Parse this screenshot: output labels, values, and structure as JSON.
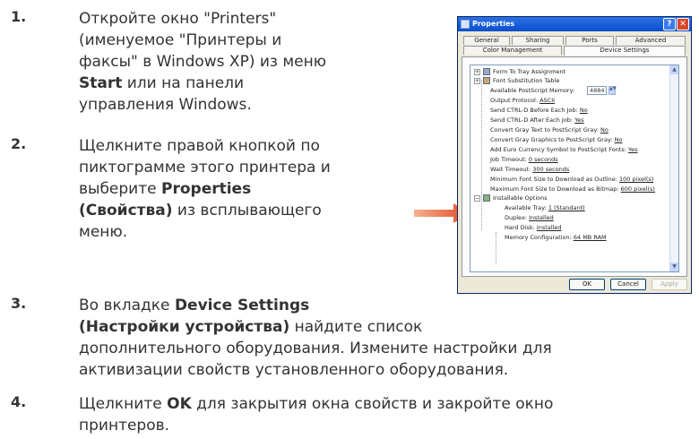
{
  "steps": [
    {
      "number": "1.",
      "lines": [
        [
          {
            "text": "Откройте окно \"Printers\""
          }
        ],
        [
          {
            "text": "(именуемое \"Принтеры и"
          }
        ],
        [
          {
            "text": "факсы\" в Windows XP) из меню"
          }
        ],
        [
          {
            "text": "Start",
            "bold": true
          },
          {
            "text": " или на панели"
          }
        ],
        [
          {
            "text": "управления Windows."
          }
        ]
      ]
    },
    {
      "number": "2.",
      "lines": [
        [
          {
            "text": "Щелкните правой кнопкой по"
          }
        ],
        [
          {
            "text": "пиктограмме этого принтера и"
          }
        ],
        [
          {
            "text": "выберите "
          },
          {
            "text": "Properties",
            "bold": true
          }
        ],
        [
          {
            "text": "(Свойства)",
            "bold": true
          },
          {
            "text": " из всплывающего"
          }
        ],
        [
          {
            "text": "меню."
          }
        ]
      ]
    },
    {
      "number": "3.",
      "lines": [
        [
          {
            "text": "Во вкладке "
          },
          {
            "text": "Device Settings",
            "bold": true
          }
        ],
        [
          {
            "text": "(Настройки устройства)",
            "bold": true
          },
          {
            "text": " найдите список"
          }
        ],
        [
          {
            "text": "дополнительного оборудования. Измените настройки для"
          }
        ],
        [
          {
            "text": "активизации свойств установленного оборудования."
          }
        ]
      ]
    },
    {
      "number": "4.",
      "lines": [
        [
          {
            "text": "Щелкните "
          },
          {
            "text": "OK",
            "bold": true
          },
          {
            "text": " для закрытия окна свойств и закройте окно"
          }
        ],
        [
          {
            "text": "принтеров."
          }
        ]
      ]
    }
  ],
  "dialog": {
    "title": "Properties",
    "help_glyph": "?",
    "close_glyph": "✕",
    "tabs_row1": [
      "General",
      "Sharing",
      "Ports",
      "Advanced"
    ],
    "tabs_row2": [
      "Color Management",
      "Device Settings"
    ],
    "active_tab": "Device Settings",
    "tree": {
      "form_to_tray": "Form To Tray Assignment",
      "font_substitution": "Font Substitution Table",
      "ps_memory_label": "Available PostScript Memory:",
      "ps_memory_value": "4884",
      "output_protocol_label": "Output Protocol:",
      "output_protocol_value": "ASCII",
      "ctrl_d_before_label": "Send CTRL-D Before Each Job:",
      "ctrl_d_before_value": "No",
      "ctrl_d_after_label": "Send CTRL-D After Each Job:",
      "ctrl_d_after_value": "Yes",
      "gray_text_label": "Convert Gray Text to PostScript Gray:",
      "gray_text_value": "No",
      "gray_graphics_label": "Convert Gray Graphics to PostScript Gray:",
      "gray_graphics_value": "No",
      "euro_label": "Add Euro Currency Symbol to PostScript Fonts:",
      "euro_value": "Yes",
      "job_timeout_label": "Job Timeout:",
      "job_timeout_value": "0 seconds",
      "wait_timeout_label": "Wait Timeout:",
      "wait_timeout_value": "300 seconds",
      "min_font_label": "Minimum Font Size to Download as Outline:",
      "min_font_value": "100 pixel(s)",
      "max_font_label": "Maximum Font Size to Download as Bitmap:",
      "max_font_value": "600 pixel(s)",
      "installable_options": "Installable Options",
      "tray_label": "Available Tray:",
      "tray_value": "1 (Standard)",
      "duplex_label": "Duplex:",
      "duplex_value": "Installed",
      "hard_disk_label": "Hard Disk:",
      "hard_disk_value": "Installed",
      "memory_label": "Memory Configuration:",
      "memory_value": "64 MB RAM"
    },
    "buttons": {
      "ok": "OK",
      "cancel": "Cancel",
      "apply": "Apply"
    }
  },
  "colors": {
    "arrow": "#e8663a",
    "text": "#333333",
    "xp_blue": "#0a4fcf"
  }
}
